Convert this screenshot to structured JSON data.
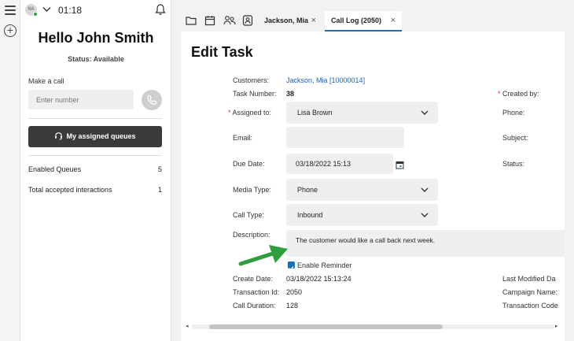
{
  "agent": {
    "initials": "NA",
    "timer": "01:18",
    "greeting": "Hello John Smith",
    "status": "Status: Available",
    "make_call_label": "Make a call",
    "number_placeholder": "Enter number",
    "queues_button": "My assigned queues",
    "stats": [
      {
        "label": "Enabled Queues",
        "value": "5"
      },
      {
        "label": "Total accepted interactions",
        "value": "1"
      }
    ]
  },
  "tabs": [
    {
      "label": "Jackson, Mia",
      "close": "×"
    },
    {
      "label": "Call Log (2050)",
      "close": "×"
    }
  ],
  "form": {
    "title": "Edit Task",
    "customers_label": "Customers:",
    "customers_value": "Jackson, Mia [10000014]",
    "task_number_label": "Task Number:",
    "task_number_value": "38",
    "assigned_to_label": "Assigned to:",
    "assigned_to_value": "Lisa Brown",
    "email_label": "Email:",
    "email_value": "",
    "due_date_label": "Due Date:",
    "due_date_value": "03/18/2022 15:13",
    "media_type_label": "Media Type:",
    "media_type_value": "Phone",
    "call_type_label": "Call Type:",
    "call_type_value": "Inbound",
    "description_label": "Description:",
    "description_value": "The customer would like a call back next week.",
    "enable_reminder_label": "Enable Reminder",
    "enable_reminder_checked": true,
    "create_date_label": "Create Date:",
    "create_date_value": "03/18/2022 15:13:24",
    "transaction_id_label": "Transaction Id:",
    "transaction_id_value": "2050",
    "call_duration_label": "Call Duration:",
    "call_duration_value": "128",
    "created_by_label": "Created by:",
    "phone_label": "Phone:",
    "subject_label": "Subject:",
    "status_label": "Status:",
    "last_modified_label": "Last Modified Da",
    "campaign_name_label": "Campaign Name:",
    "transaction_code_label": "Transaction Code"
  },
  "colors": {
    "accent": "#1a6fb6",
    "link": "#1a62b8",
    "arrow": "#2f9e3e",
    "dark_button": "#3a3a3a"
  }
}
